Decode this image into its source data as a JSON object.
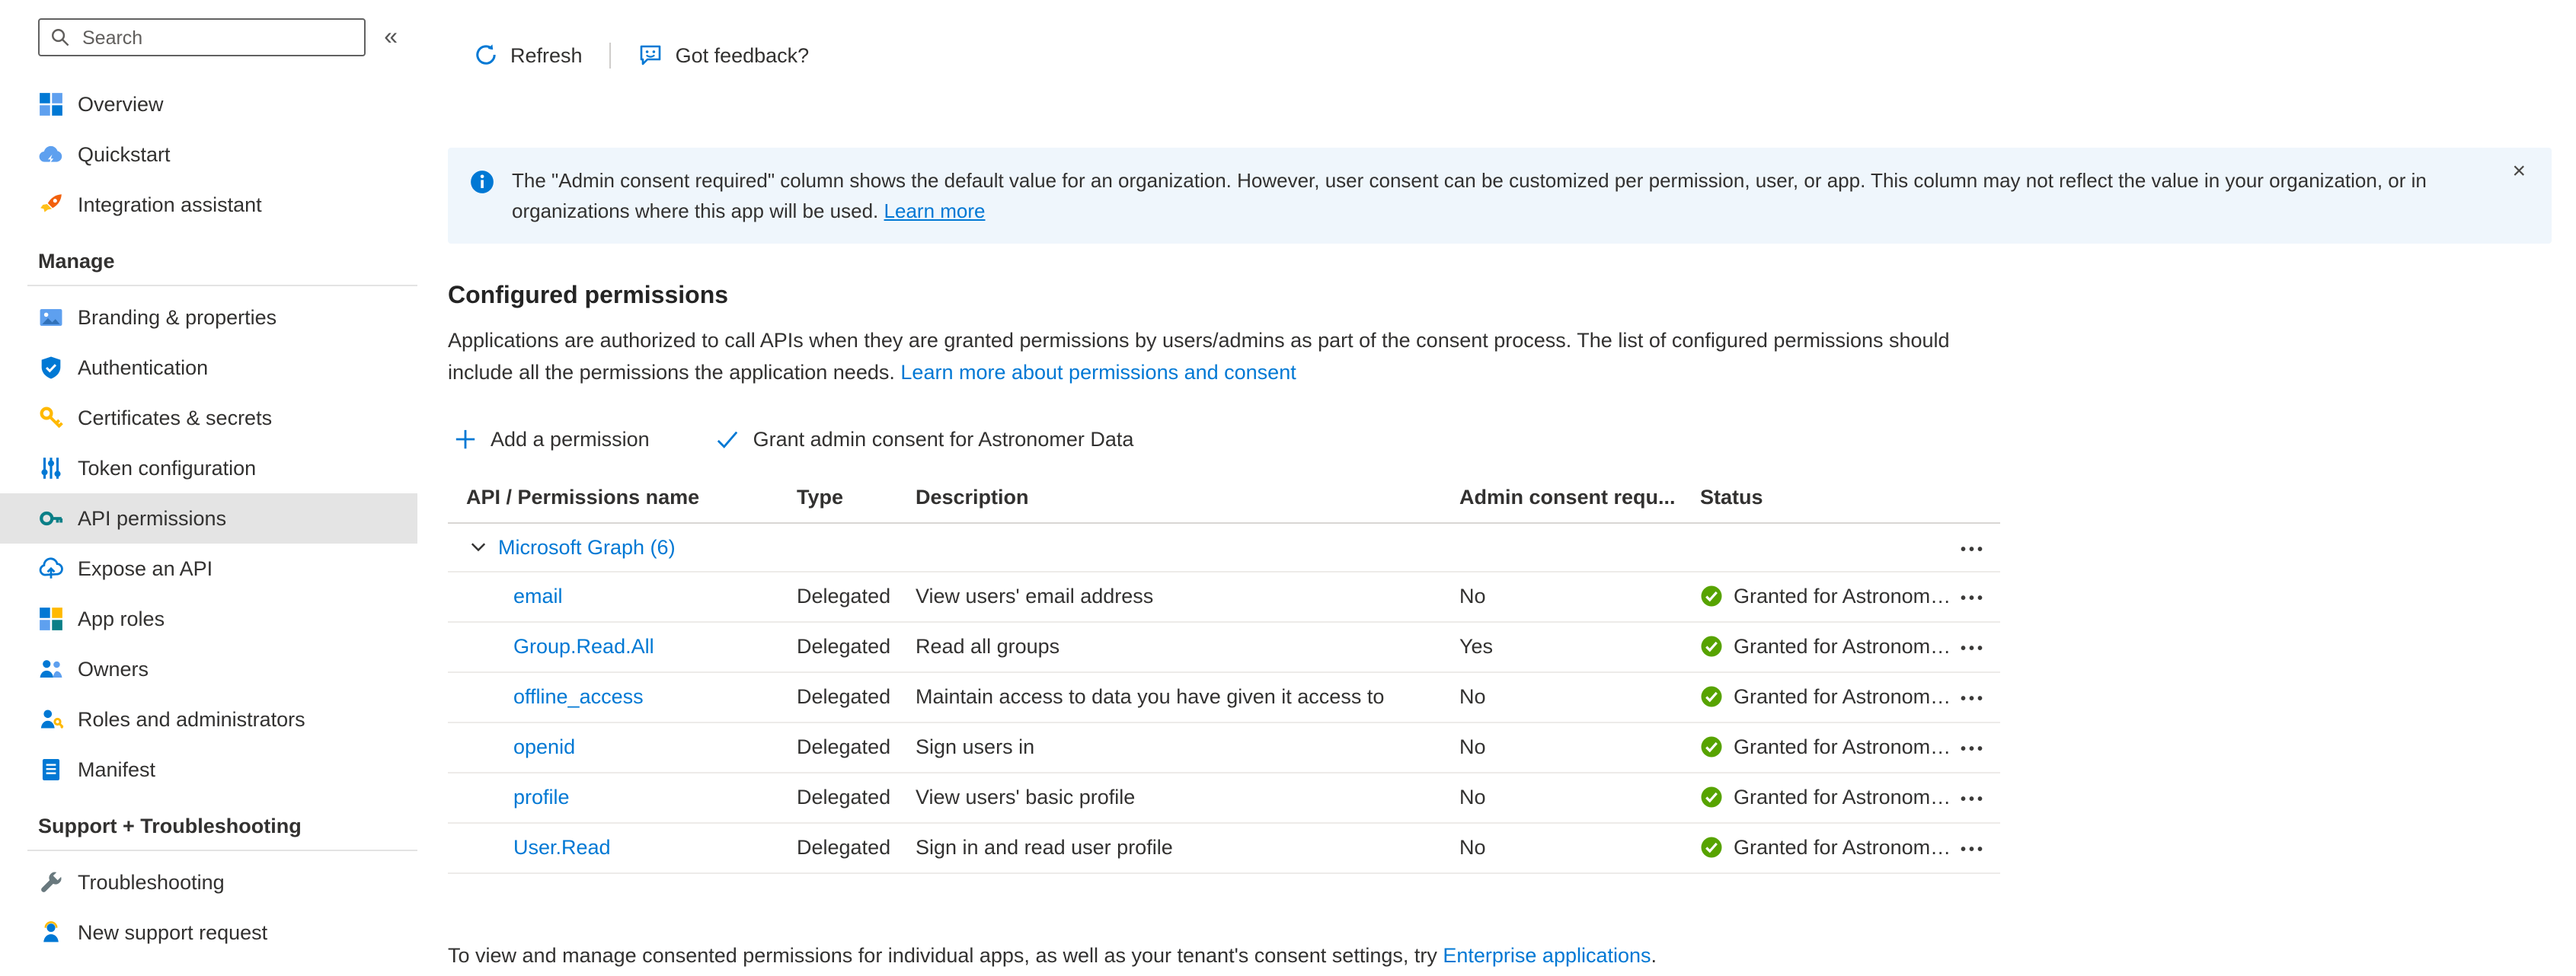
{
  "colors": {
    "accent": "#0078d4",
    "text": "#323130",
    "banner-bg": "#eff6fc",
    "selected-bg": "#e4e4e4",
    "success": "#57a300"
  },
  "sidebar": {
    "search_placeholder": "Search",
    "collapse_glyph": "«",
    "top_items": [
      {
        "label": "Overview",
        "icon": "overview-icon"
      },
      {
        "label": "Quickstart",
        "icon": "quickstart-icon"
      },
      {
        "label": "Integration assistant",
        "icon": "integration-assistant-icon"
      }
    ],
    "sections": [
      {
        "title": "Manage",
        "items": [
          {
            "label": "Branding & properties",
            "icon": "branding-icon"
          },
          {
            "label": "Authentication",
            "icon": "authentication-icon"
          },
          {
            "label": "Certificates & secrets",
            "icon": "certificates-icon"
          },
          {
            "label": "Token configuration",
            "icon": "token-configuration-icon"
          },
          {
            "label": "API permissions",
            "icon": "api-permissions-icon",
            "selected": true
          },
          {
            "label": "Expose an API",
            "icon": "expose-api-icon"
          },
          {
            "label": "App roles",
            "icon": "app-roles-icon"
          },
          {
            "label": "Owners",
            "icon": "owners-icon"
          },
          {
            "label": "Roles and administrators",
            "icon": "roles-administrators-icon"
          },
          {
            "label": "Manifest",
            "icon": "manifest-icon"
          }
        ]
      },
      {
        "title": "Support + Troubleshooting",
        "items": [
          {
            "label": "Troubleshooting",
            "icon": "troubleshooting-icon"
          },
          {
            "label": "New support request",
            "icon": "new-support-request-icon"
          }
        ]
      }
    ]
  },
  "toolbar": {
    "refresh_label": "Refresh",
    "feedback_label": "Got feedback?"
  },
  "banner": {
    "message": "The \"Admin consent required\" column shows the default value for an organization. However, user consent can be customized per permission, user, or app. This column may not reflect the value in your organization, or in organizations where this app will be used.",
    "link_label": "Learn more",
    "close_glyph": "×"
  },
  "content": {
    "title": "Configured permissions",
    "description": "Applications are authorized to call APIs when they are granted permissions by users/admins as part of the consent process. The list of configured permissions should include all the permissions the application needs.",
    "description_link": "Learn more about permissions and consent",
    "add_permission_label": "Add a permission",
    "grant_admin_label": "Grant admin consent for Astronomer Data",
    "table": {
      "columns": [
        "API / Permissions name",
        "Type",
        "Description",
        "Admin consent requ...",
        "Status"
      ],
      "group_label": "Microsoft Graph (6)",
      "menu_glyph": "•••",
      "rows": [
        {
          "name": "email",
          "type": "Delegated",
          "description": "View users' email address",
          "admin_consent": "No",
          "status": "Granted for Astronomer..."
        },
        {
          "name": "Group.Read.All",
          "type": "Delegated",
          "description": "Read all groups",
          "admin_consent": "Yes",
          "status": "Granted for Astronomer..."
        },
        {
          "name": "offline_access",
          "type": "Delegated",
          "description": "Maintain access to data you have given it access to",
          "admin_consent": "No",
          "status": "Granted for Astronomer..."
        },
        {
          "name": "openid",
          "type": "Delegated",
          "description": "Sign users in",
          "admin_consent": "No",
          "status": "Granted for Astronomer..."
        },
        {
          "name": "profile",
          "type": "Delegated",
          "description": "View users' basic profile",
          "admin_consent": "No",
          "status": "Granted for Astronomer..."
        },
        {
          "name": "User.Read",
          "type": "Delegated",
          "description": "Sign in and read user profile",
          "admin_consent": "No",
          "status": "Granted for Astronomer..."
        }
      ]
    },
    "footer": {
      "text": "To view and manage consented permissions for individual apps, as well as your tenant's consent settings, try ",
      "link_label": "Enterprise applications",
      "suffix": "."
    }
  }
}
